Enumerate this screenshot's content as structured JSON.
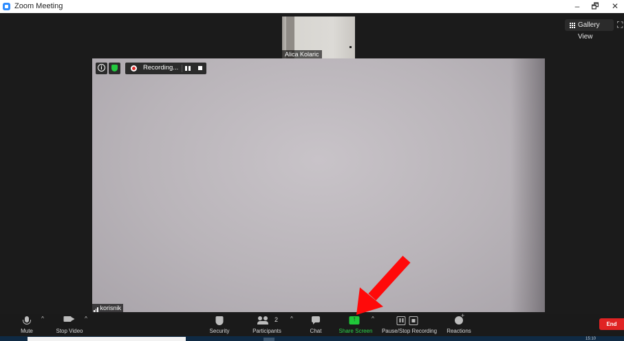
{
  "window": {
    "title": "Zoom Meeting",
    "controls": {
      "minimize": "–",
      "maximize": "🗗",
      "close": "✕"
    }
  },
  "view": {
    "gallery_label": "Gallery View"
  },
  "thumbnail": {
    "name": "Alica Kolaric"
  },
  "recording": {
    "status": "Recording..."
  },
  "main_video": {
    "name": "korisnik"
  },
  "toolbar": {
    "mute": "Mute",
    "stop_video": "Stop Video",
    "security": "Security",
    "participants": "Participants",
    "participant_count": "2",
    "chat": "Chat",
    "share_screen": "Share Screen",
    "pause_stop_recording": "Pause/Stop Recording",
    "reactions": "Reactions",
    "end": "End"
  },
  "colors": {
    "share_green": "#1fc739",
    "recording_red": "#e02828",
    "end_red": "#e02424",
    "annotation_arrow": "#ff0a0a"
  },
  "icons": [
    "app-icon",
    "gallery-grid-icon",
    "fullscreen-icon",
    "info-icon",
    "shield-icon",
    "record-icon",
    "pause-icon",
    "stop-icon",
    "signal-icon",
    "microphone-icon",
    "camera-icon",
    "people-icon",
    "chat-icon",
    "share-arrow-icon",
    "smiley-icon"
  ]
}
